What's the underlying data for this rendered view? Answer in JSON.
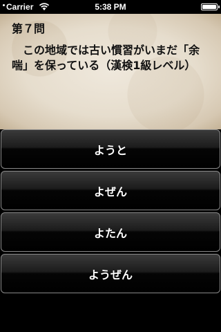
{
  "status_bar": {
    "carrier": "Carrier",
    "time": "5:38 PM",
    "battery_level": 1.0
  },
  "question": {
    "number_label": "第７問",
    "text": "この地域では古い慣習がいまだ「余喘」を保っている（漢検1級レベル）"
  },
  "answers": [
    {
      "label": "ようと"
    },
    {
      "label": "よぜん"
    },
    {
      "label": "よたん"
    },
    {
      "label": "ようぜん"
    }
  ]
}
